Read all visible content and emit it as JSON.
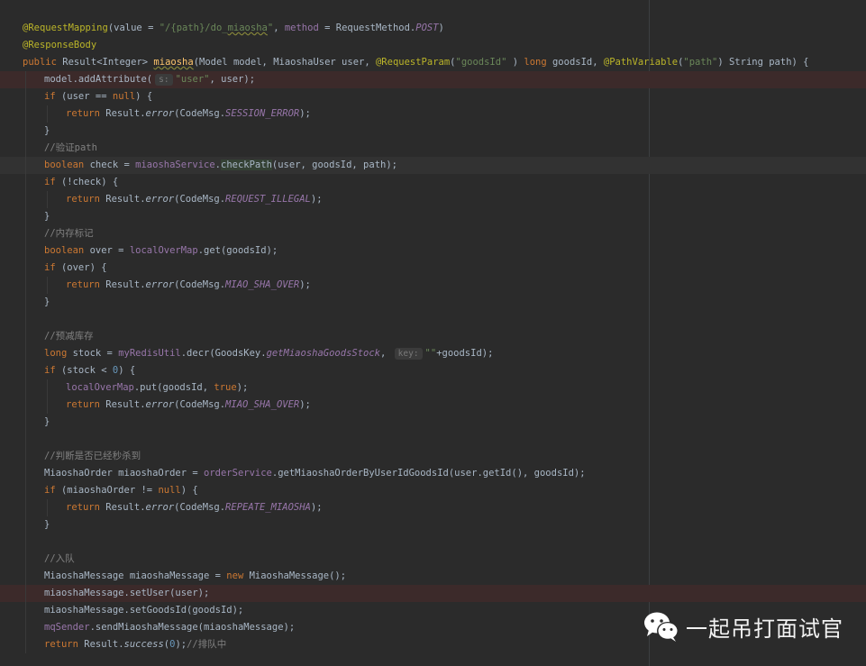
{
  "editor": {
    "lines": [
      {
        "segments": [
          [
            "ann",
            "@RequestMapping"
          ],
          [
            "",
            "(value = "
          ],
          [
            "str",
            "\"/{path}/do_"
          ],
          [
            "str squig",
            "miaosha"
          ],
          [
            "str",
            "\""
          ],
          [
            "",
            ", "
          ],
          [
            "fld",
            "method"
          ],
          [
            "",
            " = RequestMethod."
          ],
          [
            "ifld",
            "POST"
          ],
          [
            "",
            ")"
          ]
        ]
      },
      {
        "segments": [
          [
            "ann",
            "@ResponseBody"
          ]
        ]
      },
      {
        "segments": [
          [
            "kw",
            "public "
          ],
          [
            "",
            "Result<Integer> "
          ],
          [
            "meth squig",
            "miaosha"
          ],
          [
            "",
            "(Model model, MiaoshaUser user, "
          ],
          [
            "ann",
            "@RequestParam"
          ],
          [
            "",
            "("
          ],
          [
            "str",
            "\"goodsId\""
          ],
          [
            "",
            " ) "
          ],
          [
            "kw",
            "long "
          ],
          [
            "",
            "goodsId, "
          ],
          [
            "ann",
            "@PathVariable"
          ],
          [
            "",
            "("
          ],
          [
            "str",
            "\"path\""
          ],
          [
            "",
            ") String path) {"
          ]
        ]
      },
      {
        "segments": [
          [
            "",
            "model.addAttribute("
          ],
          [
            "hint",
            "s:"
          ],
          [
            "str",
            "\"user\""
          ],
          [
            "",
            ", user);"
          ]
        ]
      },
      {
        "segments": [
          [
            "kw",
            "if "
          ],
          [
            "",
            "(user == "
          ],
          [
            "kw",
            "null"
          ],
          [
            "",
            ") {"
          ]
        ]
      },
      {
        "segments": [
          [
            "kw",
            "return "
          ],
          [
            "",
            "Result."
          ],
          [
            "smeth",
            "error"
          ],
          [
            "",
            "(CodeMsg."
          ],
          [
            "ifld",
            "SESSION_ERROR"
          ],
          [
            "",
            ");"
          ]
        ]
      },
      {
        "segments": [
          [
            "",
            "}"
          ]
        ]
      },
      {
        "segments": [
          [
            "cmt",
            "//验证path"
          ]
        ]
      },
      {
        "segments": [
          [
            "kw",
            "boolean "
          ],
          [
            "",
            "check = "
          ],
          [
            "fld",
            "miaoshaService"
          ],
          [
            "",
            "."
          ],
          [
            "hl",
            "checkPath"
          ],
          [
            "",
            "(user, goodsId, path);"
          ]
        ]
      },
      {
        "segments": [
          [
            "kw",
            "if "
          ],
          [
            "",
            "(!check) {"
          ]
        ]
      },
      {
        "segments": [
          [
            "kw",
            "return "
          ],
          [
            "",
            "Result."
          ],
          [
            "smeth",
            "error"
          ],
          [
            "",
            "(CodeMsg."
          ],
          [
            "ifld",
            "REQUEST_ILLEGAL"
          ],
          [
            "",
            ");"
          ]
        ]
      },
      {
        "segments": [
          [
            "",
            "}"
          ]
        ]
      },
      {
        "segments": [
          [
            "cmt",
            "//内存标记"
          ]
        ]
      },
      {
        "segments": [
          [
            "kw",
            "boolean "
          ],
          [
            "",
            "over = "
          ],
          [
            "fld",
            "localOverMap"
          ],
          [
            "",
            ".get(goodsId);"
          ]
        ]
      },
      {
        "segments": [
          [
            "kw",
            "if "
          ],
          [
            "",
            "(over) {"
          ]
        ]
      },
      {
        "segments": [
          [
            "kw",
            "return "
          ],
          [
            "",
            "Result."
          ],
          [
            "smeth",
            "error"
          ],
          [
            "",
            "(CodeMsg."
          ],
          [
            "ifld",
            "MIAO_SHA_OVER"
          ],
          [
            "",
            ");"
          ]
        ]
      },
      {
        "segments": [
          [
            "",
            "}"
          ]
        ]
      },
      {
        "segments": []
      },
      {
        "segments": [
          [
            "cmt",
            "//预减库存"
          ]
        ]
      },
      {
        "segments": [
          [
            "kw",
            "long "
          ],
          [
            "",
            "stock = "
          ],
          [
            "fld",
            "myRedisUtil"
          ],
          [
            "",
            ".decr(GoodsKey."
          ],
          [
            "ifld",
            "getMiaoshaGoodsStock"
          ],
          [
            "",
            ", "
          ],
          [
            "hint",
            "key:"
          ],
          [
            "str",
            "\"\""
          ],
          [
            "",
            "+goodsId);"
          ]
        ]
      },
      {
        "segments": [
          [
            "kw",
            "if "
          ],
          [
            "",
            "(stock < "
          ],
          [
            "num",
            "0"
          ],
          [
            "",
            ") {"
          ]
        ]
      },
      {
        "segments": [
          [
            "fld",
            "localOverMap"
          ],
          [
            "",
            ".put(goodsId, "
          ],
          [
            "kw",
            "true"
          ],
          [
            "",
            ");"
          ]
        ]
      },
      {
        "segments": [
          [
            "kw",
            "return "
          ],
          [
            "",
            "Result."
          ],
          [
            "smeth",
            "error"
          ],
          [
            "",
            "(CodeMsg."
          ],
          [
            "ifld",
            "MIAO_SHA_OVER"
          ],
          [
            "",
            ");"
          ]
        ]
      },
      {
        "segments": [
          [
            "",
            "}"
          ]
        ]
      },
      {
        "segments": []
      },
      {
        "segments": [
          [
            "cmt",
            "//判断是否已经秒杀到"
          ]
        ]
      },
      {
        "segments": [
          [
            "",
            "MiaoshaOrder miaoshaOrder = "
          ],
          [
            "fld",
            "orderService"
          ],
          [
            "",
            ".getMiaoshaOrderByUserIdGoodsId(user.getId(), goodsId);"
          ]
        ]
      },
      {
        "segments": [
          [
            "kw",
            "if "
          ],
          [
            "",
            "(miaoshaOrder != "
          ],
          [
            "kw",
            "null"
          ],
          [
            "",
            ") {"
          ]
        ]
      },
      {
        "segments": [
          [
            "kw",
            "return "
          ],
          [
            "",
            "Result."
          ],
          [
            "smeth",
            "error"
          ],
          [
            "",
            "(CodeMsg."
          ],
          [
            "ifld",
            "REPEATE_MIAOSHA"
          ],
          [
            "",
            ");"
          ]
        ]
      },
      {
        "segments": [
          [
            "",
            "}"
          ]
        ]
      },
      {
        "segments": []
      },
      {
        "segments": [
          [
            "cmt",
            "//入队"
          ]
        ]
      },
      {
        "segments": [
          [
            "",
            "MiaoshaMessage miaoshaMessage = "
          ],
          [
            "kw",
            "new "
          ],
          [
            "",
            "MiaoshaMessage();"
          ]
        ]
      },
      {
        "segments": [
          [
            "",
            "miaoshaMessage.setUser(user);"
          ]
        ]
      },
      {
        "segments": [
          [
            "",
            "miaoshaMessage.setGoodsId(goodsId);"
          ]
        ]
      },
      {
        "segments": [
          [
            "fld",
            "mqSender"
          ],
          [
            "",
            ".sendMiaoshaMessage(miaoshaMessage);"
          ]
        ]
      },
      {
        "segments": [
          [
            "kw",
            "return "
          ],
          [
            "",
            "Result."
          ],
          [
            "smeth",
            "success"
          ],
          [
            "",
            "("
          ],
          [
            "num",
            "0"
          ],
          [
            "",
            ");"
          ],
          [
            "cmt",
            "//排队中"
          ]
        ]
      }
    ]
  },
  "watermark": {
    "icon": "wechat-icon",
    "text": "一起吊打面试官"
  }
}
